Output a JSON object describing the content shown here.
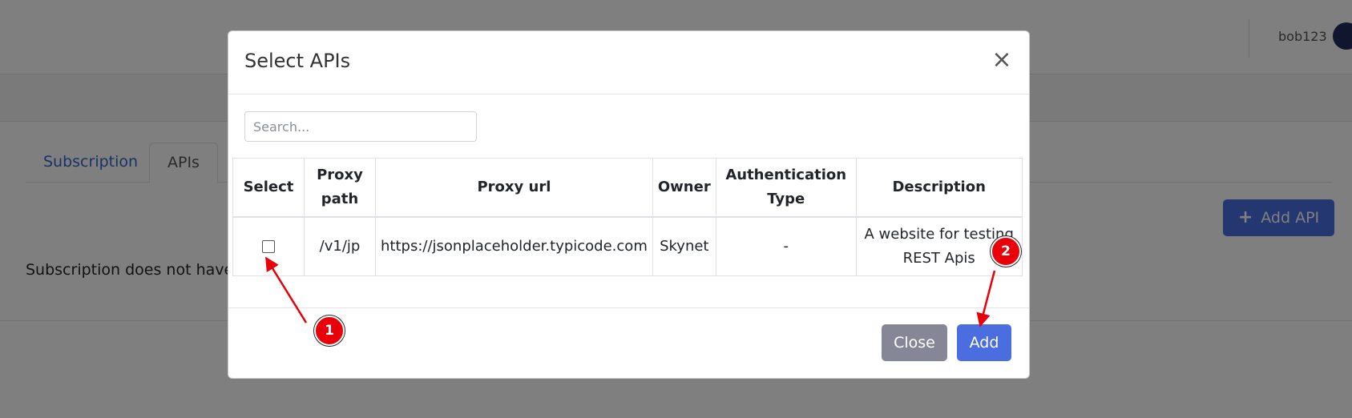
{
  "header": {
    "username": "bob123",
    "avatar_icon": "user-circle-icon"
  },
  "tabs": [
    {
      "label": "Subscription"
    },
    {
      "label": "APIs"
    }
  ],
  "add_api_button": {
    "label": "Add API",
    "icon": "plus-icon"
  },
  "empty_message": "Subscription does not have A",
  "modal": {
    "title": "Select APIs",
    "close_icon": "×",
    "search": {
      "placeholder": "Search...",
      "value": ""
    },
    "table": {
      "headers": [
        "Select",
        "Proxy path",
        "Proxy url",
        "Owner",
        "Authentication Type",
        "Description"
      ],
      "rows": [
        {
          "selected": false,
          "proxy_path": "/v1/jp",
          "proxy_url": "https://jsonplaceholder.typicode.com",
          "owner": "Skynet",
          "auth_type": "-",
          "description": "A website for testing REST Apis"
        }
      ]
    },
    "footer": {
      "close_label": "Close",
      "add_label": "Add"
    }
  },
  "annotations": [
    {
      "label": "1"
    },
    {
      "label": "2"
    }
  ],
  "colors": {
    "primary": "#4a6ee0",
    "secondary": "#858796",
    "annotation": "#e8000b",
    "link": "#3366cc"
  }
}
